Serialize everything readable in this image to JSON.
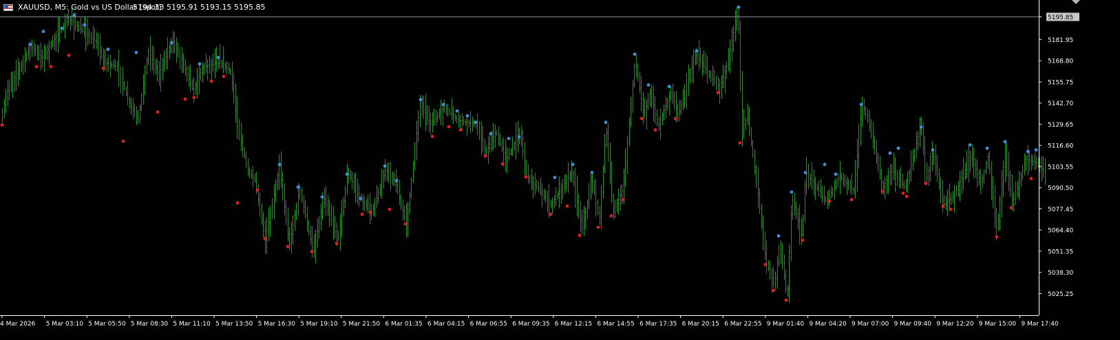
{
  "window": {
    "symbol_info": "XAUUSD, M5:  Gold vs US Dollar (spot)",
    "quote_values": "5194.33 5195.91 5193.15 5195.85",
    "flag_icon": "us-flag-icon",
    "scroll_icon": "triangle-down-icon"
  },
  "colors": {
    "background": "#000000",
    "bar_up": "#1f9a1f",
    "bar_down": "#2a8a2a",
    "pivot_high": "#3d8fe0",
    "pivot_low": "#e02020",
    "axis": "#ffffff",
    "bid_line": "#7f8c9a",
    "bid_label_bg": "#c8c8c8"
  },
  "chart_data": {
    "type": "ohlc",
    "timeframe": "M5",
    "current_price": 5195.85,
    "y_ticks": [
      "5195.85",
      "5181.95",
      "5168.80",
      "5155.75",
      "5142.70",
      "5129.65",
      "5116.60",
      "5103.55",
      "5090.50",
      "5077.45",
      "5064.40",
      "5051.35",
      "5038.30",
      "5025.25"
    ],
    "x_ticks": [
      "4 Mar 2026",
      "5 Mar 03:10",
      "5 Mar 05:50",
      "5 Mar 08:30",
      "5 Mar 11:10",
      "5 Mar 13:50",
      "5 Mar 16:30",
      "5 Mar 19:10",
      "5 Mar 21:50",
      "6 Mar 01:35",
      "6 Mar 04:15",
      "6 Mar 06:55",
      "6 Mar 09:35",
      "6 Mar 12:15",
      "6 Mar 14:55",
      "6 Mar 17:35",
      "6 Mar 20:15",
      "6 Mar 22:55",
      "9 Mar 01:40",
      "9 Mar 04:20",
      "9 Mar 07:00",
      "9 Mar 09:40",
      "9 Mar 12:20",
      "9 Mar 15:00",
      "9 Mar 17:40"
    ],
    "bar_count": 600,
    "price_path": [
      [
        0,
        5131
      ],
      [
        10,
        5150
      ],
      [
        25,
        5162
      ],
      [
        45,
        5178
      ],
      [
        60,
        5170
      ],
      [
        80,
        5183
      ],
      [
        100,
        5195
      ],
      [
        120,
        5187
      ],
      [
        140,
        5180
      ],
      [
        150,
        5168
      ],
      [
        170,
        5165
      ],
      [
        185,
        5145
      ],
      [
        200,
        5132
      ],
      [
        215,
        5175
      ],
      [
        230,
        5160
      ],
      [
        250,
        5181
      ],
      [
        265,
        5168
      ],
      [
        280,
        5150
      ],
      [
        295,
        5165
      ],
      [
        320,
        5168
      ],
      [
        335,
        5162
      ],
      [
        345,
        5127
      ],
      [
        360,
        5100
      ],
      [
        370,
        5095
      ],
      [
        385,
        5058
      ],
      [
        395,
        5080
      ],
      [
        405,
        5104
      ],
      [
        420,
        5055
      ],
      [
        435,
        5090
      ],
      [
        455,
        5050
      ],
      [
        470,
        5085
      ],
      [
        490,
        5058
      ],
      [
        505,
        5100
      ],
      [
        525,
        5082
      ],
      [
        540,
        5075
      ],
      [
        560,
        5102
      ],
      [
        575,
        5092
      ],
      [
        590,
        5068
      ],
      [
        610,
        5143
      ],
      [
        625,
        5130
      ],
      [
        645,
        5140
      ],
      [
        665,
        5132
      ],
      [
        690,
        5130
      ],
      [
        705,
        5112
      ],
      [
        720,
        5125
      ],
      [
        735,
        5108
      ],
      [
        755,
        5125
      ],
      [
        765,
        5098
      ],
      [
        800,
        5080
      ],
      [
        830,
        5100
      ],
      [
        845,
        5065
      ],
      [
        860,
        5095
      ],
      [
        870,
        5070
      ],
      [
        880,
        5128
      ],
      [
        890,
        5075
      ],
      [
        905,
        5090
      ],
      [
        922,
        5170
      ],
      [
        935,
        5135
      ],
      [
        945,
        5150
      ],
      [
        955,
        5128
      ],
      [
        975,
        5150
      ],
      [
        985,
        5135
      ],
      [
        1010,
        5173
      ],
      [
        1030,
        5160
      ],
      [
        1045,
        5152
      ],
      [
        1055,
        5165
      ],
      [
        1072,
        5200
      ],
      [
        1078,
        5125
      ],
      [
        1085,
        5135
      ],
      [
        1100,
        5090
      ],
      [
        1112,
        5045
      ],
      [
        1125,
        5030
      ],
      [
        1132,
        5058
      ],
      [
        1143,
        5022
      ],
      [
        1150,
        5085
      ],
      [
        1165,
        5060
      ],
      [
        1170,
        5100
      ],
      [
        1200,
        5082
      ],
      [
        1220,
        5098
      ],
      [
        1240,
        5088
      ],
      [
        1252,
        5143
      ],
      [
        1265,
        5125
      ],
      [
        1282,
        5090
      ],
      [
        1295,
        5102
      ],
      [
        1315,
        5090
      ],
      [
        1338,
        5130
      ],
      [
        1345,
        5095
      ],
      [
        1355,
        5112
      ],
      [
        1370,
        5080
      ],
      [
        1385,
        5085
      ],
      [
        1410,
        5110
      ],
      [
        1425,
        5093
      ],
      [
        1435,
        5110
      ],
      [
        1448,
        5063
      ],
      [
        1460,
        5115
      ],
      [
        1470,
        5080
      ],
      [
        1490,
        5108
      ],
      [
        1505,
        5106
      ],
      [
        1518,
        5100
      ]
    ],
    "pivot_highs": [
      [
        44,
        5178
      ],
      [
        63,
        5186
      ],
      [
        90,
        5188
      ],
      [
        108,
        5196
      ],
      [
        123,
        5190
      ],
      [
        157,
        5175
      ],
      [
        198,
        5173
      ],
      [
        249,
        5179
      ],
      [
        290,
        5166
      ],
      [
        317,
        5170
      ],
      [
        406,
        5104
      ],
      [
        433,
        5090
      ],
      [
        468,
        5084
      ],
      [
        504,
        5098
      ],
      [
        524,
        5083
      ],
      [
        559,
        5103
      ],
      [
        576,
        5094
      ],
      [
        611,
        5144
      ],
      [
        644,
        5141
      ],
      [
        664,
        5137
      ],
      [
        679,
        5134
      ],
      [
        691,
        5130
      ],
      [
        713,
        5123
      ],
      [
        739,
        5120
      ],
      [
        754,
        5121
      ],
      [
        806,
        5096
      ],
      [
        832,
        5104
      ],
      [
        860,
        5099
      ],
      [
        880,
        5130
      ],
      [
        922,
        5172
      ],
      [
        942,
        5153
      ],
      [
        972,
        5152
      ],
      [
        1012,
        5174
      ],
      [
        1073,
        5201
      ],
      [
        1131,
        5060
      ],
      [
        1150,
        5087
      ],
      [
        1170,
        5099
      ],
      [
        1198,
        5104
      ],
      [
        1214,
        5098
      ],
      [
        1251,
        5141
      ],
      [
        1293,
        5111
      ],
      [
        1305,
        5114
      ],
      [
        1338,
        5127
      ],
      [
        1355,
        5113
      ],
      [
        1409,
        5116
      ],
      [
        1434,
        5114
      ],
      [
        1460,
        5118
      ],
      [
        1493,
        5112
      ],
      [
        1505,
        5113
      ]
    ],
    "pivot_lows": [
      [
        3,
        5130
      ],
      [
        53,
        5166
      ],
      [
        74,
        5166
      ],
      [
        100,
        5173
      ],
      [
        150,
        5165
      ],
      [
        179,
        5120
      ],
      [
        229,
        5138
      ],
      [
        269,
        5146
      ],
      [
        282,
        5147
      ],
      [
        307,
        5157
      ],
      [
        325,
        5160
      ],
      [
        345,
        5082
      ],
      [
        374,
        5090
      ],
      [
        385,
        5060
      ],
      [
        418,
        5055
      ],
      [
        453,
        5052
      ],
      [
        489,
        5057
      ],
      [
        526,
        5075
      ],
      [
        538,
        5076
      ],
      [
        566,
        5078
      ],
      [
        589,
        5069
      ],
      [
        628,
        5123
      ],
      [
        652,
        5129
      ],
      [
        669,
        5127
      ],
      [
        705,
        5111
      ],
      [
        730,
        5106
      ],
      [
        764,
        5098
      ],
      [
        800,
        5075
      ],
      [
        824,
        5080
      ],
      [
        842,
        5062
      ],
      [
        869,
        5067
      ],
      [
        888,
        5074
      ],
      [
        905,
        5084
      ],
      [
        932,
        5134
      ],
      [
        952,
        5127
      ],
      [
        981,
        5134
      ],
      [
        1043,
        5150
      ],
      [
        1075,
        5119
      ],
      [
        1112,
        5044
      ],
      [
        1124,
        5028
      ],
      [
        1142,
        5022
      ],
      [
        1166,
        5059
      ],
      [
        1205,
        5083
      ],
      [
        1237,
        5084
      ],
      [
        1282,
        5089
      ],
      [
        1312,
        5088
      ],
      [
        1317,
        5086
      ],
      [
        1345,
        5094
      ],
      [
        1370,
        5080
      ],
      [
        1381,
        5078
      ],
      [
        1448,
        5061
      ],
      [
        1469,
        5079
      ],
      [
        1498,
        5097
      ]
    ]
  }
}
